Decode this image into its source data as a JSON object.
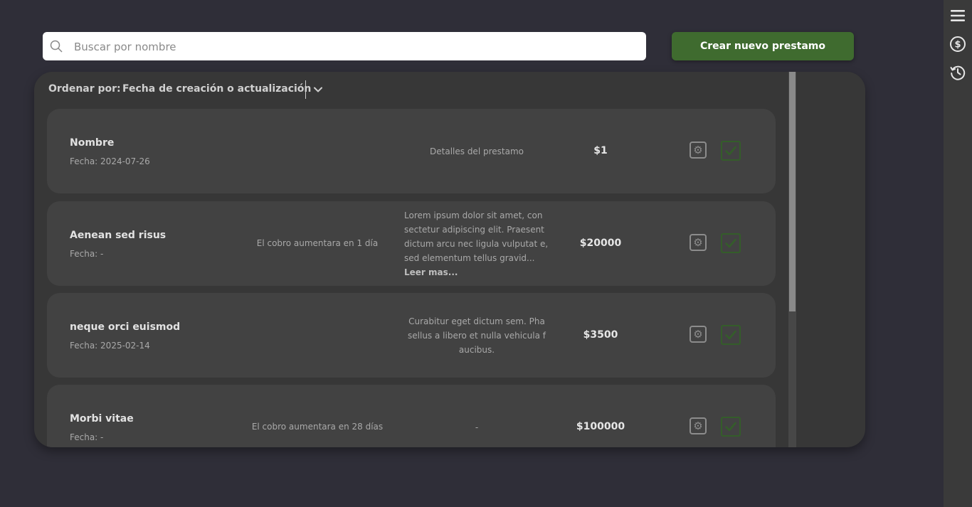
{
  "search": {
    "placeholder": "Buscar por nombre"
  },
  "actions": {
    "create_label": "Crear nuevo prestamo"
  },
  "sort": {
    "label": "Ordenar por:",
    "value": "Fecha de creación o actualización"
  },
  "sidebar": {
    "icons": [
      "menu-icon",
      "dollar-icon",
      "history-icon"
    ]
  },
  "colors": {
    "accent": "#3f6b2f",
    "check": "#345d2a",
    "background": "#2f2e38",
    "panel": "#373737",
    "card": "#424242"
  },
  "loans": [
    {
      "name": "Nombre",
      "date": "Fecha: 2024-07-26",
      "status": "",
      "details": "Detalles del prestamo",
      "read_more": "",
      "amount": "$1"
    },
    {
      "name": "Aenean sed risus",
      "date": "Fecha: -",
      "status": "El cobro aumentara en 1 día",
      "details": "Lorem ipsum dolor sit amet, con sectetur adipiscing elit. Praesent dictum arcu nec ligula vulputat e, sed elementum tellus gravid...",
      "read_more": "Leer mas...",
      "amount": "$20000"
    },
    {
      "name": "neque orci euismod",
      "date": "Fecha: 2025-02-14",
      "status": "",
      "details": "Curabitur eget dictum sem. Pha sellus a libero et nulla vehicula f aucibus.",
      "read_more": "",
      "amount": "$3500"
    },
    {
      "name": "Morbi vitae",
      "date": "Fecha: -",
      "status": "El cobro aumentara en 28 días",
      "details": "-",
      "read_more": "",
      "amount": "$100000"
    }
  ]
}
